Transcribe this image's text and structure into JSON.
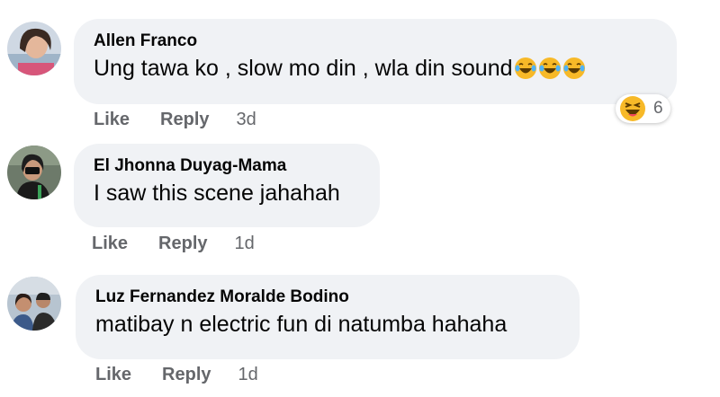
{
  "comments": [
    {
      "author": "Allen Franco",
      "text": "Ung tawa ko , slow mo din , wla din sound",
      "emoji": [
        "laughing-crying-emoji",
        "laughing-crying-emoji",
        "laughing-crying-emoji"
      ],
      "like_label": "Like",
      "reply_label": "Reply",
      "time": "3d",
      "reaction": {
        "icon": "haha-reaction-icon",
        "count": "6"
      }
    },
    {
      "author": "El Jhonna Duyag-Mama",
      "text": "I saw this scene jahahah",
      "like_label": "Like",
      "reply_label": "Reply",
      "time": "1d"
    },
    {
      "author": "Luz Fernandez Moralde Bodino",
      "text": "matibay n electric fun di natumba hahaha",
      "like_label": "Like",
      "reply_label": "Reply",
      "time": "1d"
    }
  ],
  "colors": {
    "bubble": "#f0f2f5",
    "text": "#050505",
    "secondary": "#65676b",
    "haha_yellow": "#f7b928"
  }
}
